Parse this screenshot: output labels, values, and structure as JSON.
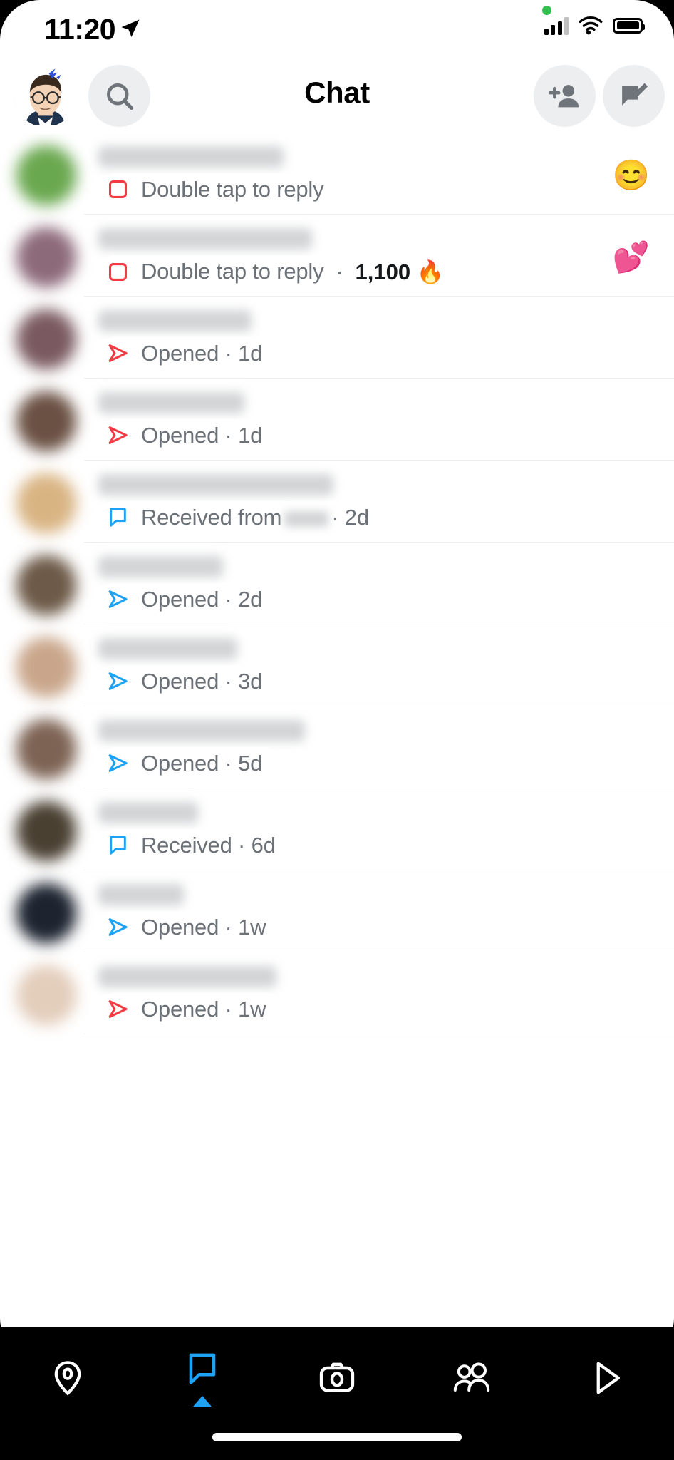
{
  "status_bar": {
    "time": "11:20",
    "location_icon": "location-arrow-icon",
    "recording_dot_color": "#30c14e",
    "signal_icon": "cellular-signal-icon",
    "wifi_icon": "wifi-icon",
    "battery_icon": "battery-full-icon"
  },
  "header": {
    "title": "Chat",
    "avatar_icon": "bitmoji-avatar",
    "search_icon": "search-icon",
    "add_friend_icon": "add-friend-icon",
    "new_chat_icon": "new-chat-icon"
  },
  "chat_list": {
    "rows": [
      {
        "name_hidden": true,
        "name_width": 260,
        "avatar_color": "#6aa84f",
        "status_icon": "square-outline-icon",
        "status_icon_color": "#f23b43",
        "status": "Double tap to reply",
        "time": "",
        "streak": "",
        "emoji": "😊",
        "emoji_name": "smiling-face-emoji"
      },
      {
        "name_hidden": true,
        "name_width": 300,
        "avatar_color": "#8d6a7a",
        "status_icon": "square-outline-icon",
        "status_icon_color": "#f23b43",
        "status": "Double tap to reply",
        "time": "",
        "streak": "1,100 🔥",
        "emoji": "💕",
        "emoji_name": "two-hearts-emoji"
      },
      {
        "name_hidden": true,
        "name_width": 215,
        "avatar_color": "#7a5a60",
        "status_icon": "arrow-outline-icon",
        "status_icon_color": "#f23b43",
        "status": "Opened",
        "time": "1d",
        "streak": "",
        "emoji": "",
        "emoji_name": ""
      },
      {
        "name_hidden": true,
        "name_width": 205,
        "avatar_color": "#6b5144",
        "status_icon": "arrow-outline-icon",
        "status_icon_color": "#f23b43",
        "status": "Opened",
        "time": "1d",
        "streak": "",
        "emoji": "",
        "emoji_name": ""
      },
      {
        "name_hidden": true,
        "name_width": 330,
        "avatar_color": "#d9b483",
        "status_icon": "chat-bubble-outline-icon",
        "status_icon_color": "#1ea2f5",
        "status": "Received from",
        "time": "2d",
        "streak": "",
        "inline_blur_name": true,
        "emoji": "",
        "emoji_name": ""
      },
      {
        "name_hidden": true,
        "name_width": 175,
        "avatar_color": "#6d5a48",
        "status_icon": "arrow-outline-icon",
        "status_icon_color": "#1ea2f5",
        "status": "Opened",
        "time": "2d",
        "streak": "",
        "emoji": "",
        "emoji_name": ""
      },
      {
        "name_hidden": true,
        "name_width": 195,
        "avatar_color": "#c9a68b",
        "status_icon": "arrow-outline-icon",
        "status_icon_color": "#1ea2f5",
        "status": "Opened",
        "time": "3d",
        "streak": "",
        "emoji": "",
        "emoji_name": ""
      },
      {
        "name_hidden": true,
        "name_width": 290,
        "avatar_color": "#7d6354",
        "status_icon": "arrow-outline-icon",
        "status_icon_color": "#1ea2f5",
        "status": "Opened",
        "time": "5d",
        "streak": "",
        "emoji": "",
        "emoji_name": ""
      },
      {
        "name_hidden": true,
        "name_width": 140,
        "avatar_color": "#4a4032",
        "status_icon": "chat-bubble-outline-icon",
        "status_icon_color": "#1ea2f5",
        "status": "Received",
        "time": "6d",
        "streak": "",
        "emoji": "",
        "emoji_name": ""
      },
      {
        "name_hidden": true,
        "name_width": 120,
        "avatar_color": "#1d2430",
        "status_icon": "arrow-outline-icon",
        "status_icon_color": "#1ea2f5",
        "status": "Opened",
        "time": "1w",
        "streak": "",
        "emoji": "",
        "emoji_name": ""
      },
      {
        "name_hidden": true,
        "name_width": 250,
        "avatar_color": "#e3cdbb",
        "status_icon": "arrow-outline-icon",
        "status_icon_color": "#f23b43",
        "status": "Opened",
        "time": "1w",
        "streak": "",
        "emoji": "",
        "emoji_name": ""
      }
    ],
    "separator_dot": "·"
  },
  "bottom_nav": {
    "active_index": 1,
    "active_color": "#1ea2f5",
    "items": [
      {
        "icon": "map-pin-icon",
        "name": "map"
      },
      {
        "icon": "chat-bubble-icon",
        "name": "chat"
      },
      {
        "icon": "camera-icon",
        "name": "camera"
      },
      {
        "icon": "friends-icon",
        "name": "friends"
      },
      {
        "icon": "spotlight-play-icon",
        "name": "spotlight"
      }
    ]
  }
}
